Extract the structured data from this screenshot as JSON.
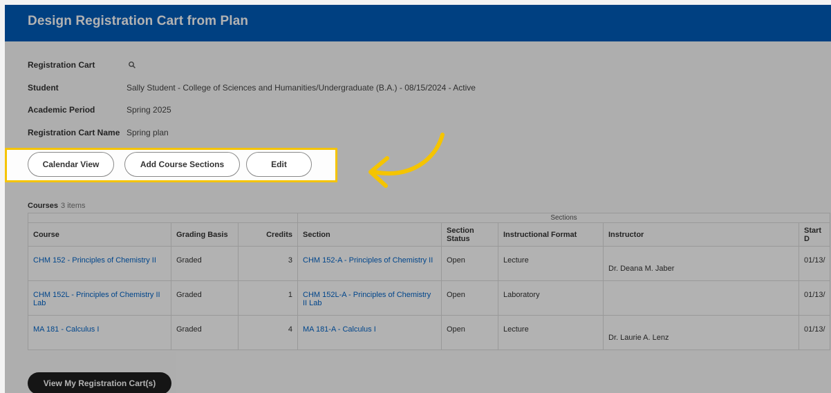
{
  "header": {
    "title": "Design Registration Cart from Plan"
  },
  "fields": [
    {
      "label": "Registration Cart",
      "value": ""
    },
    {
      "label": "Student",
      "value": "Sally Student - College of Sciences and Humanities/Undergraduate (B.A.) - 08/15/2024 - Active"
    },
    {
      "label": "Academic Period",
      "value": "Spring 2025"
    },
    {
      "label": "Registration Cart Name",
      "value": "Spring plan"
    }
  ],
  "icons": {
    "registration_cart": "search-icon",
    "annotation": "curved-arrow-icon"
  },
  "buttons": {
    "calendar_view": "Calendar View",
    "add_course_sections": "Add Course Sections",
    "edit": "Edit",
    "view_carts": "View My Registration Cart(s)"
  },
  "courses": {
    "label": "Courses",
    "count": "3 items",
    "group_header": "Sections",
    "columns": [
      "Course",
      "Grading Basis",
      "Credits",
      "Section",
      "Section Status",
      "Instructional Format",
      "Instructor",
      "Start D"
    ],
    "rows": [
      {
        "course": "CHM 152 - Principles of Chemistry II",
        "grading": "Graded",
        "credits": "3",
        "section": "CHM 152-A - Principles of Chemistry II",
        "status": "Open",
        "format": "Lecture",
        "instructor": "Dr. Deana M. Jaber",
        "start": "01/13/"
      },
      {
        "course": "CHM 152L - Principles of Chemistry II Lab",
        "grading": "Graded",
        "credits": "1",
        "section": "CHM 152L-A - Principles of Chemistry II Lab",
        "status": "Open",
        "format": "Laboratory",
        "instructor": "",
        "start": "01/13/"
      },
      {
        "course": "MA 181 - Calculus I",
        "grading": "Graded",
        "credits": "4",
        "section": "MA 181-A - Calculus I",
        "status": "Open",
        "format": "Lecture",
        "instructor": "Dr. Laurie A. Lenz",
        "start": "01/13/"
      }
    ]
  },
  "colors": {
    "header": "#005cb9",
    "highlight": "#f5c400",
    "link": "#0063c7",
    "footer_button": "#1f1f1f"
  }
}
